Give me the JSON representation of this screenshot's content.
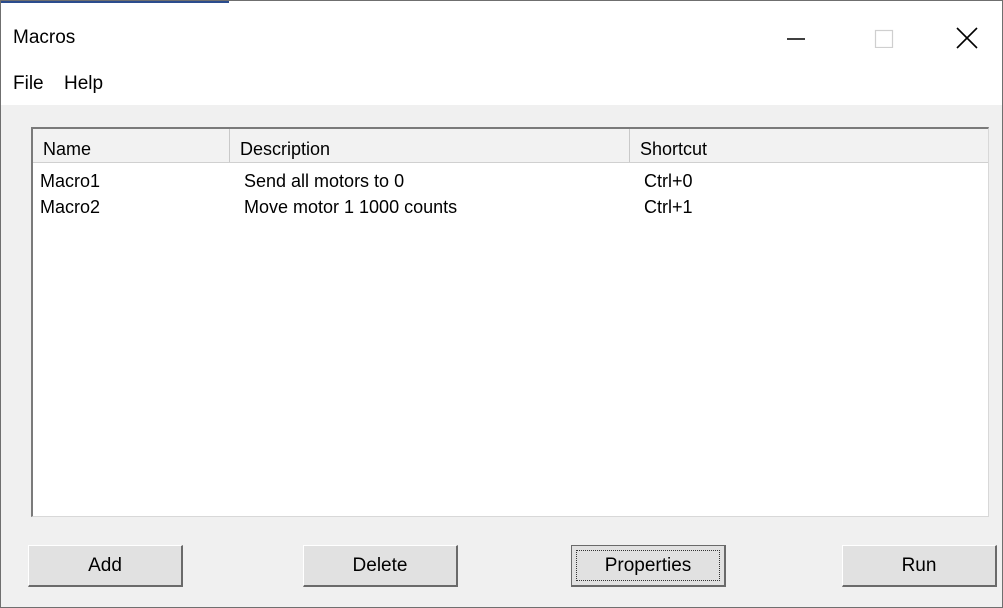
{
  "window": {
    "title": "Macros"
  },
  "menu": {
    "file": "File",
    "help": "Help"
  },
  "list": {
    "columns": [
      "Name",
      "Description",
      "Shortcut"
    ],
    "rows": [
      {
        "name": "Macro1",
        "description": "Send all motors to 0",
        "shortcut": "Ctrl+0"
      },
      {
        "name": "Macro2",
        "description": "Move motor 1 1000 counts",
        "shortcut": "Ctrl+1"
      }
    ]
  },
  "buttons": {
    "add": "Add",
    "delete": "Delete",
    "properties": "Properties",
    "run": "Run"
  },
  "icons": {
    "minimize": "minimize-icon",
    "maximize": "maximize-icon",
    "close": "close-icon"
  }
}
